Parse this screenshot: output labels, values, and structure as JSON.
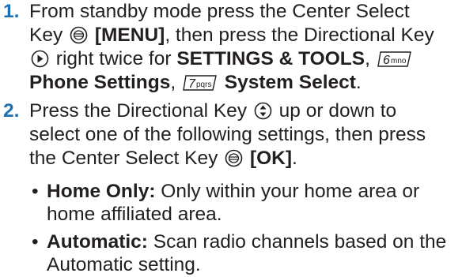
{
  "steps": [
    {
      "number": "1.",
      "lines": [
        [
          "From standby mode press the Center Select"
        ],
        [
          "Key ",
          "[MENU]",
          ", then press the Directional Key"
        ],
        [
          " right twice for ",
          "SETTINGS & TOOLS",
          ", "
        ],
        [
          "Phone Settings",
          ", ",
          "System Select",
          "."
        ]
      ]
    },
    {
      "number": "2.",
      "lines": [
        [
          "Press the Directional Key ",
          " up or down to"
        ],
        [
          "select one of the following settings, then press"
        ],
        [
          "the Center Select Key ",
          "[OK]",
          "."
        ]
      ]
    }
  ],
  "bullets": [
    {
      "symbol": "•",
      "term": "Home Only:",
      "line1": " Only within your home area or",
      "line2": "home affiliated area."
    },
    {
      "symbol": "•",
      "term": "Automatic:",
      "line1": " Scan radio channels based on the",
      "line2": "Automatic setting."
    }
  ],
  "icons": {
    "key6": {
      "digit": "6",
      "letters": "mno"
    },
    "key7": {
      "digit": "7",
      "letters": "pqrs"
    }
  },
  "colors": {
    "step_number": "#1b6fb5",
    "text": "#231f20"
  }
}
